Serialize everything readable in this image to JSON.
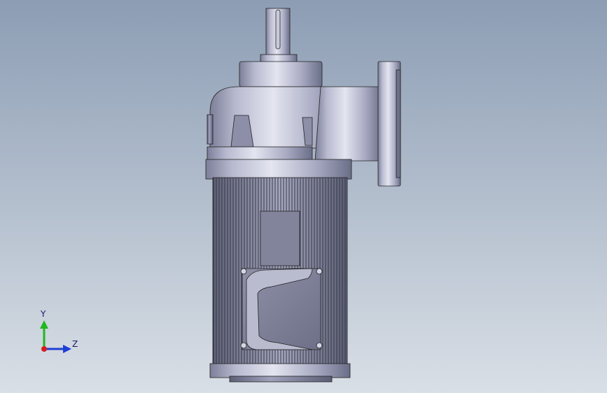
{
  "viewport": {
    "background_top": "#8c9db4",
    "background_bottom": "#d9dfe6",
    "model": "gear-motor"
  },
  "triad": {
    "y_label": "Y",
    "z_label": "Z",
    "y_color": "#1fb81f",
    "z_color": "#1f3fd6",
    "x_color": "#d41f1f"
  }
}
